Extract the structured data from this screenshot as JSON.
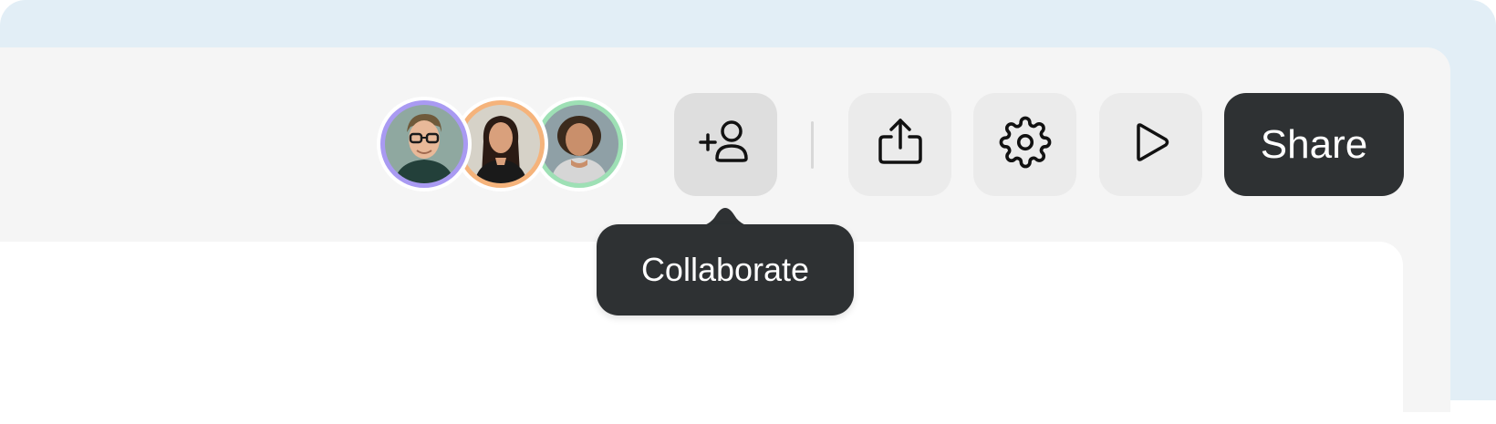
{
  "collaborators": [
    {
      "name": "avatar-man-glasses",
      "ring_color": "#a99af2",
      "skin": "#e8b999",
      "hair": "#6f5a3a",
      "shirt": "#23403a",
      "bg": "#8fa8a0"
    },
    {
      "name": "avatar-woman-dark-hair",
      "ring_color": "#f5b37b",
      "skin": "#d9a07c",
      "hair": "#2b1b14",
      "shirt": "#1a1a1a",
      "bg": "#d6d2c8"
    },
    {
      "name": "avatar-woman-curly-hair",
      "ring_color": "#9ee0b5",
      "skin": "#c98f6b",
      "hair": "#3b2a1c",
      "shirt": "#d6d6d6",
      "bg": "#8fa0a6"
    }
  ],
  "toolbar": {
    "collaborate_icon": "add-user-icon",
    "export_icon": "share-upload-icon",
    "settings_icon": "gear-icon",
    "play_icon": "play-icon",
    "share_label": "Share"
  },
  "tooltip": {
    "text": "Collaborate"
  },
  "colors": {
    "dark": "#2e3133",
    "button_bg": "#ebebeb",
    "frame_bg": "#e2eef6"
  }
}
